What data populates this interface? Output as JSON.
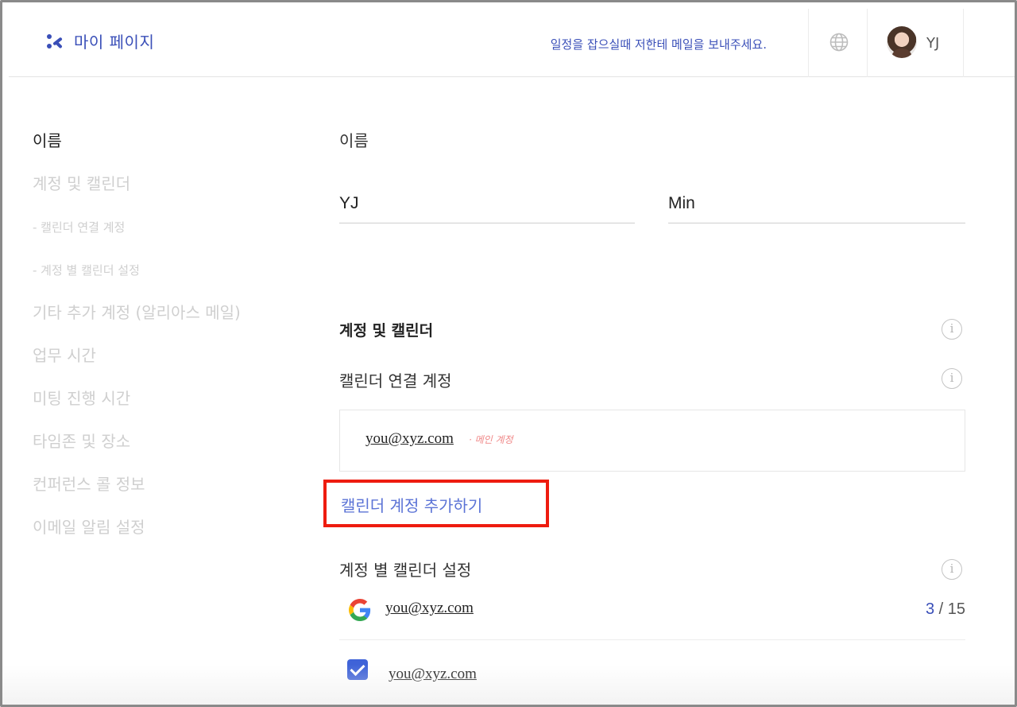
{
  "header": {
    "app_title": "마이 페이지",
    "message": "일정을 잡으실때 저한테 메일을 보내주세요.",
    "user_name": "YJ"
  },
  "sidebar": {
    "items": [
      {
        "label": "이름"
      },
      {
        "label": "계정 및 캘린더"
      },
      {
        "label": "- 캘린더 연결 계정"
      },
      {
        "label": "- 계정 별 캘린더 설정"
      },
      {
        "label": "기타 추가 계정 (알리아스 메일)"
      },
      {
        "label": "업무 시간"
      },
      {
        "label": "미팅 진행 시간"
      },
      {
        "label": "타임존 및 장소"
      },
      {
        "label": "컨퍼런스 콜 정보"
      },
      {
        "label": "이메일 알림 설정"
      }
    ]
  },
  "name_section": {
    "title": "이름",
    "first_name": "YJ",
    "last_name": "Min"
  },
  "account_section": {
    "title": "계정 및 캘린더",
    "connected_title": "캘린더 연결 계정",
    "connected_email": "you@xyz.com",
    "main_tag": "· 메인 계정",
    "add_button": "캘린더 계정 추가하기",
    "per_account_title": "계정 별 캘린더 설정",
    "google_email": "you@xyz.com",
    "selected_count": "3",
    "total_count": "15",
    "calendar_email": "you@xyz.com"
  },
  "colors": {
    "accent": "#3a4fb8",
    "highlight_border": "#ee1c0f",
    "checkbox": "#3f63d8"
  }
}
